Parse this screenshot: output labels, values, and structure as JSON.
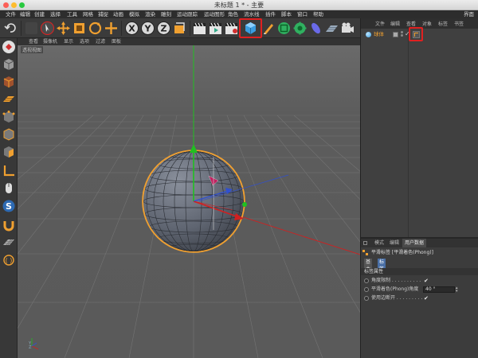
{
  "window": {
    "title": "未标题 1 * - 主要"
  },
  "menubar": {
    "items": [
      "文件",
      "编辑",
      "创建",
      "选择",
      "工具",
      "网格",
      "捕捉",
      "动画",
      "模拟",
      "渲染",
      "雕刻",
      "运动跟踪",
      "运动图形",
      "角色",
      "流水线",
      "插件",
      "脚本",
      "窗口",
      "帮助"
    ],
    "right_item": "界面"
  },
  "toolbar": {
    "highlighted_tool": "cube-object-tool"
  },
  "viewport": {
    "menu": [
      "查看",
      "摄像机",
      "显示",
      "选项",
      "过滤",
      "面板"
    ],
    "view_label": "透视视图",
    "axis_label": "Y\nZ"
  },
  "object_manager": {
    "tabs": [
      "文件",
      "编辑",
      "查看",
      "对象",
      "标签",
      "书签"
    ],
    "object_name": "球体",
    "highlighted_tag": "phong-tag"
  },
  "attribute_manager": {
    "tabs": [
      "模式",
      "编辑",
      "用户数据"
    ],
    "header": "平滑标签 [平滑着色(Phong)]",
    "subtabs": [
      "基本",
      "标签"
    ],
    "section_title": "标签属性",
    "rows": [
      {
        "label": "角度限制 . . . . . . . . . .",
        "checked": "✔"
      },
      {
        "label": "平滑着色(Phong)角度",
        "value": "40 °"
      },
      {
        "label": "使用边断开 . . . . . . . . .",
        "checked": "✔"
      }
    ]
  },
  "colors": {
    "accent_orange": "#f0a030",
    "highlight_red": "#e02020",
    "viewport_bg": "#5e5e5e",
    "axis_green": "#20c020",
    "axis_red": "#d02020",
    "axis_blue": "#3050d0"
  }
}
